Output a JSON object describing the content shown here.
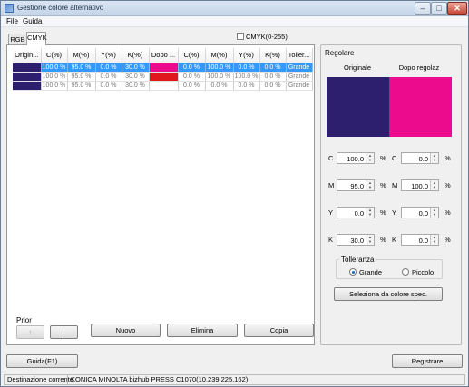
{
  "window": {
    "title": "Gestione colore alternativo"
  },
  "menu": {
    "file": "File",
    "guida": "Guida"
  },
  "tabs": [
    "RGB",
    "CMYK"
  ],
  "cmyk_range_label": "CMYK(0-255)",
  "table": {
    "headers": [
      "Origin...",
      "C(%)",
      "M(%)",
      "Y(%)",
      "K(%)",
      "Dopo ...",
      "C(%)",
      "M(%)",
      "Y(%)",
      "K(%)",
      "Toller..."
    ],
    "rows": [
      {
        "selected": true,
        "orig_color": "#2e1f6e",
        "dopo_color": "#ec0b8c",
        "orig": [
          "100.0 %",
          "95.0 %",
          "0.0 %",
          "30.0 %"
        ],
        "dopo": [
          "0.0 %",
          "100.0 %",
          "0.0 %",
          "0.0 %"
        ],
        "toll": "Grande"
      },
      {
        "selected": false,
        "orig_color": "#2e1f6e",
        "dopo_color": "#e0181e",
        "orig": [
          "100.0 %",
          "95.0 %",
          "0.0 %",
          "30.0 %"
        ],
        "dopo": [
          "0.0 %",
          "100.0 %",
          "100.0 %",
          "0.0 %"
        ],
        "toll": "Grande"
      },
      {
        "selected": false,
        "orig_color": "#2e1f6e",
        "dopo_color": "#ffffff",
        "orig": [
          "100.0 %",
          "95.0 %",
          "0.0 %",
          "30.0 %"
        ],
        "dopo": [
          "0.0 %",
          "0.0 %",
          "0.0 %",
          "0.0 %"
        ],
        "toll": "Grande"
      }
    ]
  },
  "regolare": {
    "title": "Regolare",
    "originale": "Originale",
    "dopo": "Dopo regolaz",
    "orig_color": "#2e1f6e",
    "dopo_color": "#ec0b8c",
    "values": [
      {
        "label": "C",
        "orig": "100.0",
        "dopo": "0.0"
      },
      {
        "label": "M",
        "orig": "95.0",
        "dopo": "100.0"
      },
      {
        "label": "Y",
        "orig": "0.0",
        "dopo": "0.0"
      },
      {
        "label": "K",
        "orig": "30.0",
        "dopo": "0.0"
      }
    ],
    "unit": "%",
    "tolleranza": "Tolleranza",
    "grande": "Grande",
    "piccolo": "Piccolo",
    "seleziona": "Seleziona da colore spec."
  },
  "prior": {
    "label": "Prior",
    "up": "↑",
    "down": "↓"
  },
  "actions": {
    "nuovo": "Nuovo",
    "elimina": "Elimina",
    "copia": "Copia"
  },
  "footer": {
    "guida": "Guida(F1)",
    "registrare": "Registrare"
  },
  "status": {
    "dest_label": "Destinazione corrente",
    "dest_value": "KONICA MINOLTA bizhub PRESS C1070(10.239.225.162)"
  },
  "colors": {
    "selection": "#3399ff"
  }
}
